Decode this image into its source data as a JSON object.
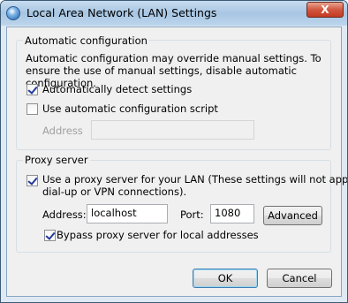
{
  "window": {
    "title": "Local Area Network (LAN) Settings",
    "close_glyph": "X",
    "icon": "network-globe-icon"
  },
  "automatic_configuration": {
    "group_label": "Automatic configuration",
    "description": "Automatic configuration may override manual settings.  To ensure the use of manual settings, disable automatic configuration.",
    "auto_detect_label": "Automatically detect settings",
    "auto_detect_checked": true,
    "use_script_label": "Use automatic configuration script",
    "use_script_checked": false,
    "address_label": "Address",
    "address_value": ""
  },
  "proxy_server": {
    "group_label": "Proxy server",
    "use_proxy_label_line1": "Use a proxy server for your LAN (These settings will not apply to",
    "use_proxy_label_line2": "dial-up or VPN connections).",
    "use_proxy_checked": true,
    "address_label": "Address:",
    "address_value": "localhost",
    "port_label": "Port:",
    "port_value": "1080",
    "advanced_button": "Advanced",
    "bypass_label": "Bypass proxy server for local addresses",
    "bypass_checked": true
  },
  "buttons": {
    "ok": "OK",
    "cancel": "Cancel"
  }
}
